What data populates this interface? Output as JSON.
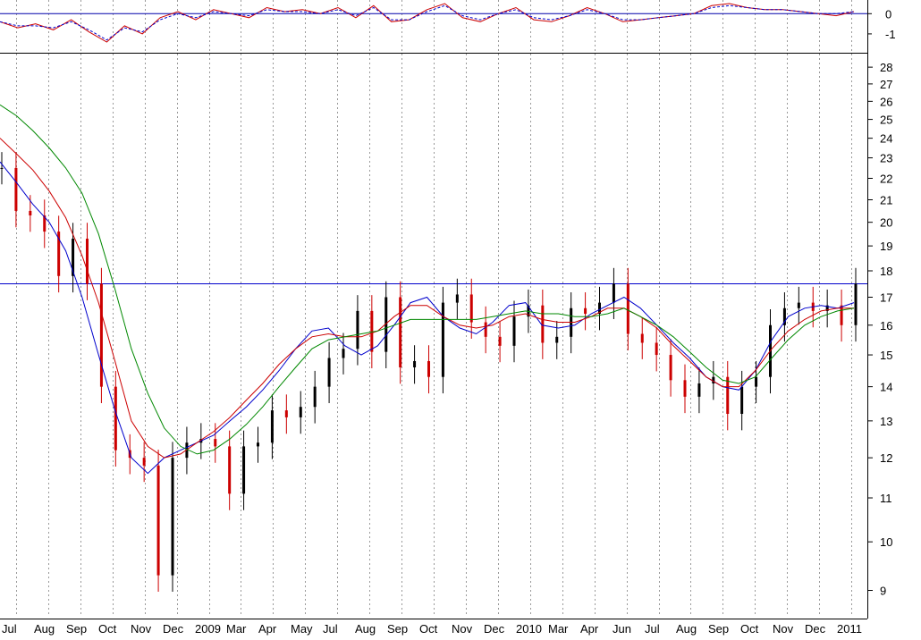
{
  "chart_data": [
    {
      "type": "line",
      "panel": "oscillator",
      "title": "",
      "y_ticks": [
        0,
        -1
      ],
      "ylim": [
        -1.8,
        0.5
      ],
      "baseline": 0,
      "series": [
        {
          "color": "#cc0000",
          "style": "solid",
          "values": [
            -0.4,
            -0.7,
            -0.5,
            -0.8,
            -0.3,
            -0.9,
            -1.4,
            -0.6,
            -1.0,
            -0.2,
            0.1,
            -0.3,
            0.2,
            0.0,
            -0.2,
            0.3,
            0.1,
            0.2,
            0.0,
            0.3,
            -0.2,
            0.4,
            -0.4,
            -0.3,
            0.2,
            0.5,
            -0.2,
            -0.4,
            0.0,
            0.3,
            -0.3,
            -0.4,
            -0.1,
            0.3,
            0.0,
            -0.4,
            -0.3,
            -0.2,
            -0.1,
            0.0,
            0.4,
            0.5,
            0.3,
            0.2,
            0.2,
            0.1,
            0.0,
            -0.1,
            0.1
          ]
        },
        {
          "color": "#0000cc",
          "style": "dashed",
          "values": [
            -0.4,
            -0.6,
            -0.6,
            -0.7,
            -0.4,
            -0.8,
            -1.3,
            -0.7,
            -0.9,
            -0.3,
            0.0,
            -0.2,
            0.1,
            0.0,
            -0.1,
            0.2,
            0.1,
            0.1,
            0.0,
            0.2,
            -0.1,
            0.3,
            -0.3,
            -0.3,
            0.1,
            0.4,
            -0.1,
            -0.3,
            0.0,
            0.2,
            -0.2,
            -0.3,
            -0.1,
            0.2,
            0.0,
            -0.3,
            -0.3,
            -0.2,
            -0.1,
            0.0,
            0.3,
            0.4,
            0.3,
            0.2,
            0.2,
            0.1,
            0.0,
            0.0,
            0.1
          ]
        }
      ]
    },
    {
      "type": "candlestick",
      "panel": "price",
      "title": "",
      "x_tick_labels": [
        "Jul",
        "Aug",
        "Sep",
        "Oct",
        "Nov",
        "Dec",
        "2009",
        "Mar",
        "Apr",
        "May",
        "Jul",
        "Aug",
        "Sep",
        "Oct",
        "Nov",
        "Dec",
        "2010",
        "Mar",
        "Apr",
        "Jun",
        "Jul",
        "Aug",
        "Sep",
        "Oct",
        "Nov",
        "Dec",
        "2011"
      ],
      "y_tick_labels": [
        28,
        27,
        26,
        25,
        24,
        23,
        22,
        21,
        20,
        19,
        18,
        17,
        16,
        15,
        14,
        13,
        12,
        11,
        10,
        9
      ],
      "y_scale": "log",
      "ylim": [
        8.5,
        28.5
      ],
      "horizontal_line": 17.5,
      "grid": "vertical dotted",
      "candles": {
        "up_color": "#000000",
        "down_color": "#cc0000",
        "close": [
          22.5,
          20.5,
          20.3,
          19.6,
          17.8,
          19.3,
          17.5,
          14.0,
          12.2,
          12.0,
          11.8,
          9.3,
          12.0,
          12.4,
          12.5,
          12.3,
          11.1,
          12.3,
          12.4,
          13.3,
          13.1,
          13.4,
          14.0,
          14.9,
          15.2,
          16.5,
          15.1,
          17.0,
          14.6,
          14.8,
          14.3,
          16.8,
          17.1,
          16.1,
          15.6,
          15.3,
          16.3,
          16.7,
          15.4,
          15.6,
          16.6,
          16.4,
          16.8,
          17.5,
          15.7,
          15.4,
          15.0,
          14.2,
          13.7,
          14.1,
          14.3,
          13.2,
          14.0,
          14.3,
          16.0,
          16.6,
          16.8,
          16.5,
          16.7,
          16.0,
          17.5
        ]
      },
      "series": [
        {
          "color": "#0000cc",
          "values": [
            22.8,
            21.8,
            20.8,
            20.0,
            18.8,
            17.0,
            15.0,
            13.3,
            12.0,
            11.6,
            12.0,
            12.2,
            12.4,
            12.6,
            13.0,
            13.4,
            13.9,
            14.5,
            15.2,
            15.8,
            15.9,
            15.3,
            15.0,
            15.3,
            16.0,
            16.8,
            17.0,
            16.3,
            15.9,
            15.7,
            16.1,
            16.7,
            16.8,
            16.0,
            15.9,
            16.0,
            16.4,
            16.7,
            17.0,
            16.6,
            16.0,
            15.4,
            14.9,
            14.3,
            14.0,
            13.9,
            14.5,
            15.5,
            16.3,
            16.6,
            16.7,
            16.6,
            16.8
          ]
        },
        {
          "color": "#cc0000",
          "values": [
            24.0,
            23.2,
            22.4,
            21.4,
            20.2,
            18.6,
            16.8,
            14.8,
            13.0,
            12.3,
            12.0,
            12.1,
            12.4,
            12.7,
            13.1,
            13.6,
            14.1,
            14.7,
            15.2,
            15.6,
            15.7,
            15.6,
            15.6,
            15.8,
            16.3,
            16.7,
            16.7,
            16.3,
            16.0,
            15.9,
            16.0,
            16.3,
            16.4,
            16.2,
            16.1,
            16.1,
            16.3,
            16.6,
            16.6,
            16.3,
            15.9,
            15.3,
            14.8,
            14.3,
            14.0,
            14.0,
            14.5,
            15.2,
            15.8,
            16.2,
            16.5,
            16.6,
            16.6
          ]
        },
        {
          "color": "#008800",
          "values": [
            25.8,
            25.2,
            24.4,
            23.5,
            22.5,
            21.3,
            19.5,
            17.3,
            15.2,
            13.8,
            12.8,
            12.3,
            12.1,
            12.2,
            12.5,
            12.9,
            13.4,
            14.0,
            14.6,
            15.2,
            15.5,
            15.6,
            15.7,
            15.8,
            16.0,
            16.2,
            16.2,
            16.2,
            16.2,
            16.2,
            16.3,
            16.4,
            16.5,
            16.4,
            16.4,
            16.3,
            16.3,
            16.4,
            16.6,
            16.3,
            16.0,
            15.6,
            15.1,
            14.6,
            14.2,
            14.1,
            14.3,
            14.9,
            15.5,
            16.0,
            16.3,
            16.5,
            16.6
          ]
        }
      ]
    }
  ]
}
